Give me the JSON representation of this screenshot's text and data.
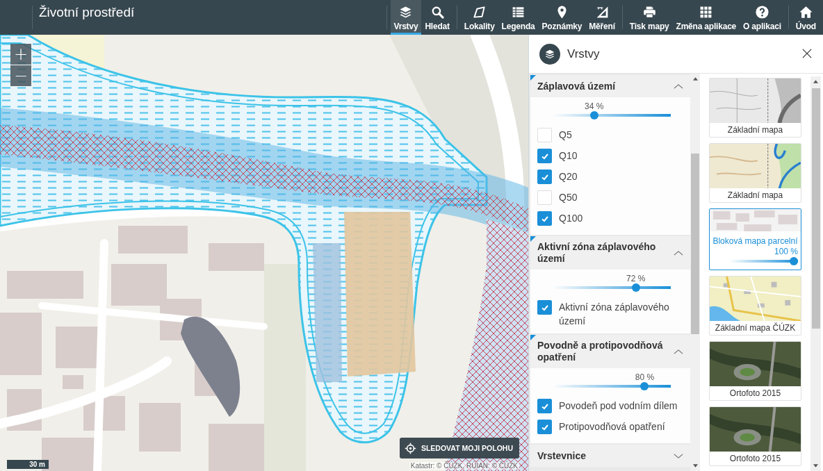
{
  "app": {
    "title": "Životní prostředí"
  },
  "toolbar": [
    [
      {
        "label": "Vrstvy",
        "selected": true
      },
      {
        "label": "Hledat",
        "selected": false
      }
    ],
    [
      {
        "label": "Lokality",
        "selected": false
      },
      {
        "label": "Legenda",
        "selected": false
      },
      {
        "label": "Poznámky",
        "selected": false
      },
      {
        "label": "Měření",
        "selected": false
      }
    ],
    [
      {
        "label": "Tisk mapy",
        "selected": false
      },
      {
        "label": "Změna aplikace",
        "selected": false
      },
      {
        "label": "O aplikaci",
        "selected": false
      }
    ],
    [
      {
        "label": "Úvod",
        "selected": false
      }
    ]
  ],
  "map": {
    "zoom_buttons": [
      "+",
      "−"
    ],
    "locate_button": "SLEDOVAT MOJI POLOHU",
    "scale": "30 m",
    "attribution": "Katastr: © ČÚZK, RÚIAN: © ČÚZK"
  },
  "panel": {
    "title": "Vrstvy",
    "sections": [
      {
        "title": "Záplavová území",
        "active": true,
        "expanded": true,
        "opacity_label": "34 %",
        "level": 0.34,
        "layers": [
          {
            "label": "Q5",
            "checked": false
          },
          {
            "label": "Q10",
            "checked": true
          },
          {
            "label": "Q20",
            "checked": true
          },
          {
            "label": "Q50",
            "checked": false
          },
          {
            "label": "Q100",
            "checked": true
          }
        ]
      },
      {
        "title": "Aktivní zóna záplavového území",
        "active": true,
        "expanded": true,
        "opacity_label": "72 %",
        "level": 0.72,
        "layers": [
          {
            "label": "Aktivní zóna záplavového území",
            "checked": true
          }
        ]
      },
      {
        "title": "Povodně a protipovodňová opatření",
        "active": true,
        "expanded": true,
        "opacity_label": "80 %",
        "level": 0.8,
        "layers": [
          {
            "label": "Povodeň pod vodním dílem",
            "checked": true
          },
          {
            "label": "Protipovodňová opatření",
            "checked": true
          }
        ]
      },
      {
        "title": "Vrstevnice",
        "active": false,
        "expanded": false
      }
    ],
    "basemaps": [
      {
        "label": "Základní mapa",
        "kind": "plan",
        "selected": false
      },
      {
        "label": "Základní mapa",
        "kind": "topo",
        "selected": false
      },
      {
        "label": "Bloková mapa parcelní",
        "kind": "parcel",
        "selected": true,
        "opacity_label": "100 %",
        "level": 1
      },
      {
        "label": "Základní mapa ČÚZK",
        "kind": "cadastral",
        "selected": false
      },
      {
        "label": "Ortofoto 2015",
        "kind": "aerial",
        "selected": false
      },
      {
        "label": "Ortofoto 2015",
        "kind": "aerial",
        "selected": false
      }
    ]
  }
}
